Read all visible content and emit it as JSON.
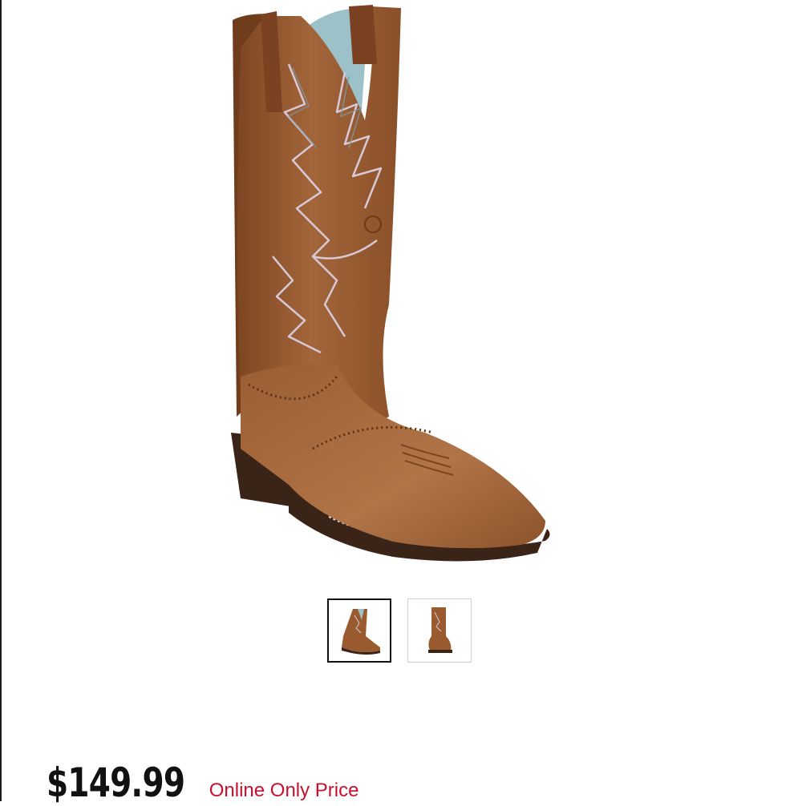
{
  "product": {
    "image_subject": "brown-western-cowboy-boot",
    "price": "$149.99",
    "price_note": "Online Only Price"
  },
  "gallery": {
    "thumbnails": [
      {
        "view": "angled-side-view",
        "selected": true
      },
      {
        "view": "front-view",
        "selected": false
      }
    ]
  },
  "colors": {
    "leather": "#9a5a30",
    "sole": "#3a2418",
    "price_note": "#c8102e",
    "selected_border": "#111111"
  }
}
